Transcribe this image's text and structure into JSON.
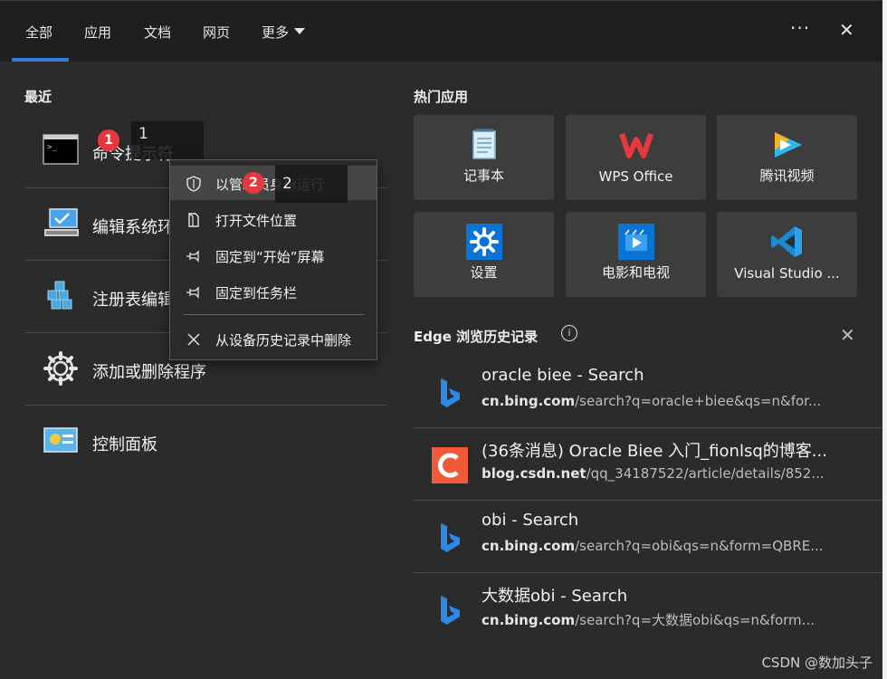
{
  "tabs": [
    {
      "label": "全部",
      "active": true
    },
    {
      "label": "应用"
    },
    {
      "label": "文档"
    },
    {
      "label": "网页"
    },
    {
      "label": "更多"
    }
  ],
  "top_icons": {
    "more": "···",
    "close": "✕"
  },
  "recent": {
    "title": "最近",
    "items": [
      {
        "label": "命令提示符",
        "icon": "cmd-icon"
      },
      {
        "label": "编辑系统环境变量",
        "icon": "computer-icon"
      },
      {
        "label": "注册表编辑器",
        "icon": "registry-icon"
      },
      {
        "label": "添加或删除程序",
        "icon": "gear-icon"
      },
      {
        "label": "控制面板",
        "icon": "control-panel-icon"
      }
    ]
  },
  "hot_apps": {
    "title": "热门应用",
    "items": [
      {
        "label": "记事本",
        "icon": "notepad-icon"
      },
      {
        "label": "WPS Office",
        "icon": "wps-icon"
      },
      {
        "label": "腾讯视频",
        "icon": "tencent-video-icon"
      },
      {
        "label": "设置",
        "icon": "settings-icon"
      },
      {
        "label": "电影和电视",
        "icon": "movies-tv-icon"
      },
      {
        "label": "Visual Studio ...",
        "icon": "vscode-icon"
      }
    ]
  },
  "edge": {
    "title": "Edge 浏览历史记录",
    "info": "i",
    "items": [
      {
        "title": "oracle biee - Search",
        "domain": "cn.bing.com",
        "path": "/search?q=oracle+biee&qs=n&for...",
        "icon": "bing-icon"
      },
      {
        "title": "(36条消息) Oracle Biee 入门_fionlsq的博客...",
        "domain": "blog.csdn.net",
        "path": "/qq_34187522/article/details/852...",
        "icon": "csdn-icon"
      },
      {
        "title": "obi - Search",
        "domain": "cn.bing.com",
        "path": "/search?q=obi&qs=n&form=QBRE...",
        "icon": "bing-icon"
      },
      {
        "title": "大数据obi - Search",
        "domain": "cn.bing.com",
        "path": "/search?q=大数据obi&qs=n&form...",
        "icon": "bing-icon"
      }
    ]
  },
  "context_menu": {
    "items": [
      {
        "label": "以管理员身份运行",
        "icon": "shield-icon"
      },
      {
        "label": "打开文件位置",
        "icon": "file-location-icon"
      },
      {
        "label": "固定到“开始”屏幕",
        "icon": "pin-icon"
      },
      {
        "label": "固定到任务栏",
        "icon": "pin-icon"
      },
      {
        "label": "从设备历史记录中删除",
        "icon": "close-icon"
      }
    ]
  },
  "annotations": {
    "badge1": "1",
    "badge2": "2",
    "callout1": "1",
    "callout2": "2"
  },
  "watermark": "CSDN @数加头子",
  "colors": {
    "accent": "#2f7ed8",
    "badge": "#e8383d",
    "background": "#2b2b2b"
  }
}
